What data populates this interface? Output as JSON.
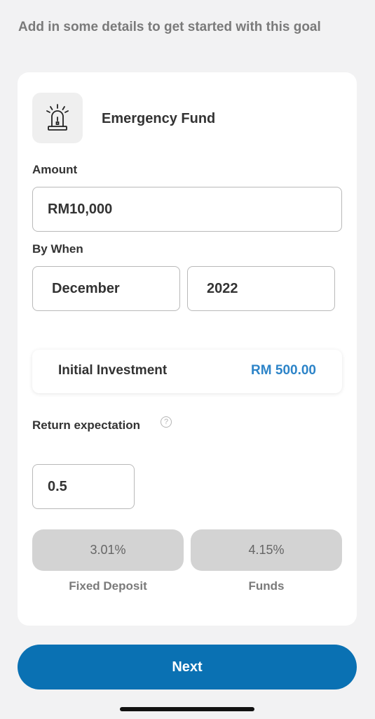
{
  "intro_text": "Add in some details to get started with this goal",
  "goal": {
    "title": "Emergency Fund",
    "icon": "siren-icon"
  },
  "amount": {
    "label": "Amount",
    "value": "RM10,000"
  },
  "by_when": {
    "label": "By When",
    "month": "December",
    "year": "2022"
  },
  "initial_investment": {
    "label": "Initial Investment",
    "value": "RM 500.00"
  },
  "return_expectation": {
    "label": "Return expectation",
    "help_glyph": "?",
    "value": "0.5"
  },
  "options": [
    {
      "rate": "3.01%",
      "label": "Fixed Deposit"
    },
    {
      "rate": "4.15%",
      "label": "Funds"
    }
  ],
  "next_label": "Next",
  "colors": {
    "accent": "#0a71b3",
    "value_blue": "#2d84c8",
    "background": "#f2f2f3",
    "pill": "#d3d3d3"
  }
}
